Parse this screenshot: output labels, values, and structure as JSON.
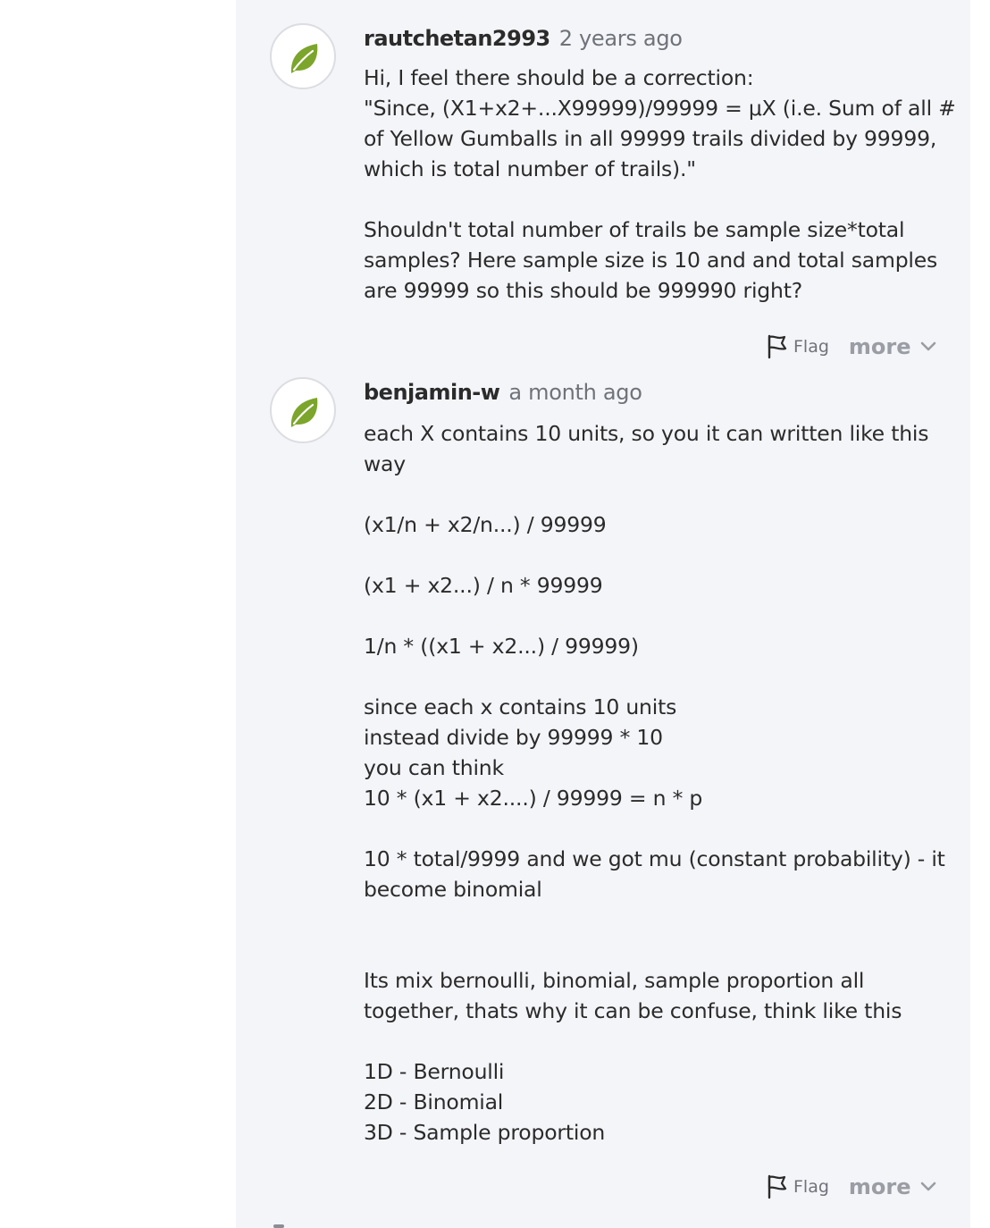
{
  "comments": [
    {
      "author": "rautchetan2993",
      "time": "2 years ago",
      "lines": [
        "Hi, I feel there should be a correction:",
        "\"Since, (X1+x2+...X99999)/99999 = μX (i.e. Sum of all #",
        "of Yellow Gumballs in all 99999 trails divided by 99999,",
        "which is total number of trails).\"",
        "",
        "Shouldn't total number of trails be sample size*total",
        "samples? Here sample size is 10 and and total samples",
        "are 99999 so this should be 999990 right?"
      ],
      "flag_label": "Flag",
      "more_label": "more"
    },
    {
      "author": "benjamin-w",
      "time": "a month ago",
      "lines": [
        "each X contains 10 units, so you it can written like this",
        "way",
        "",
        "(x1/n + x2/n...) / 99999",
        "",
        "(x1 + x2...) / n * 99999",
        "",
        "1/n * ((x1 + x2...) / 99999)",
        "",
        "since each x contains 10 units",
        "instead divide by 99999 * 10",
        "you can think",
        "10 * (x1 + x2....) / 99999 = n * p",
        "",
        "10 * total/9999 and we got mu (constant probability) - it",
        "become binomial",
        "",
        "",
        "Its mix bernoulli, binomial, sample proportion all",
        "together, thats why it can be confuse, think like this",
        "",
        "1D - Bernoulli",
        "2D - Binomial",
        "3D - Sample proportion"
      ],
      "flag_label": "Flag",
      "more_label": "more"
    }
  ],
  "icons": {
    "avatar": "leaf-icon",
    "flag": "flag-icon",
    "more": "chevron-down-icon"
  },
  "colors": {
    "thread_background": "#f4f5f9",
    "leaf": "#7ca52b",
    "author": "#2b2b2b",
    "muted": "#6f7279",
    "more": "#9a9da4"
  }
}
